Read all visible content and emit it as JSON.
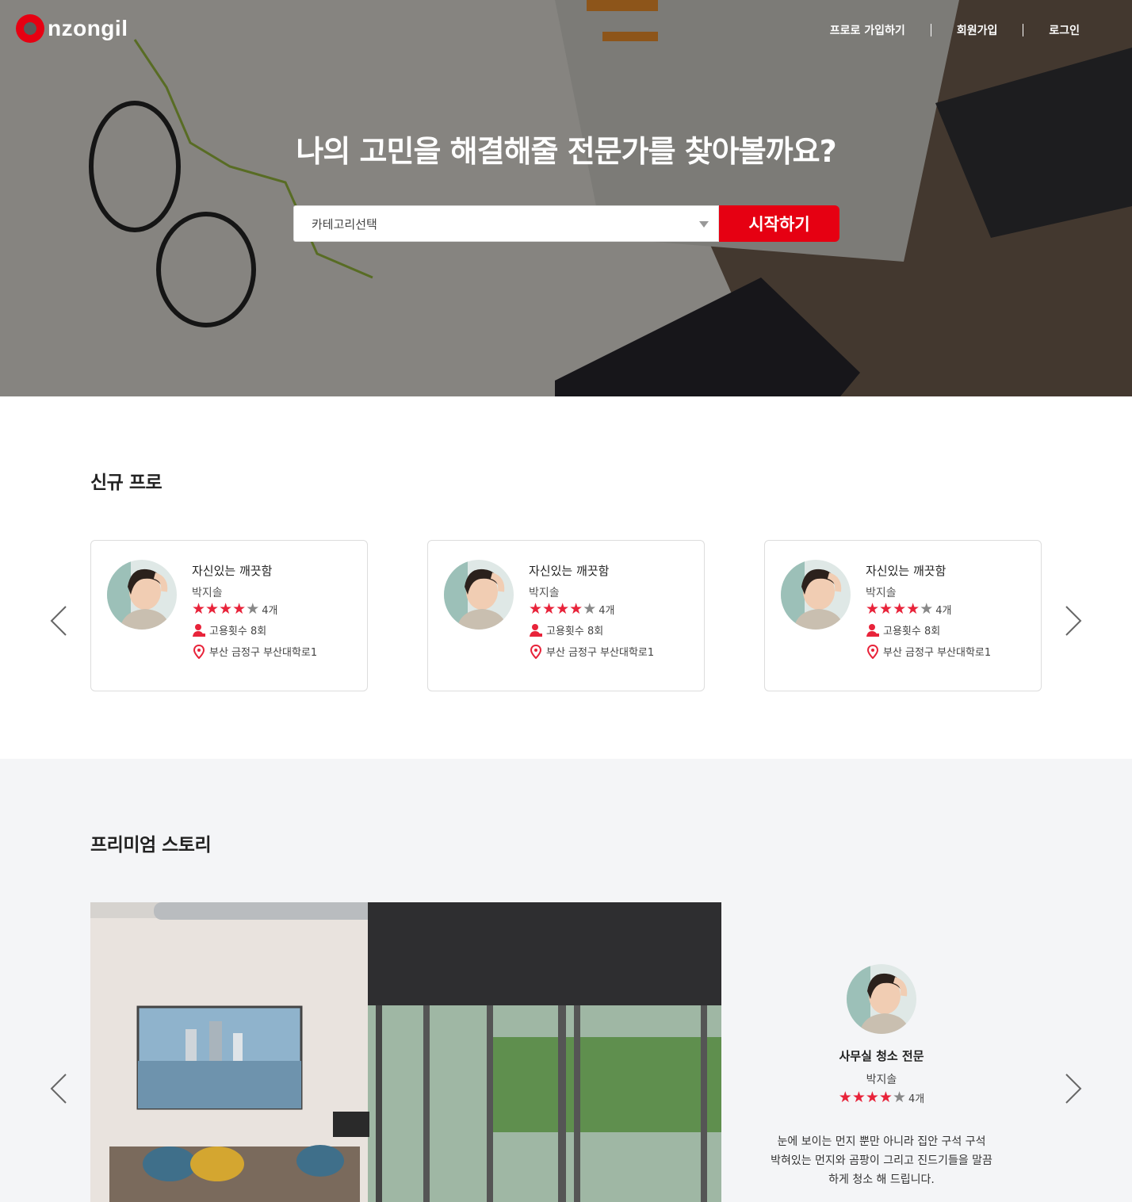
{
  "brand": {
    "logo_text": "nzongil",
    "accent": "#e60012"
  },
  "nav": {
    "items": [
      {
        "label": "프로로 가입하기"
      },
      {
        "label": "회원가입"
      },
      {
        "label": "로그인"
      }
    ]
  },
  "hero": {
    "title": "나의 고민을 해결해줄 전문가를 찾아볼까요?",
    "select_value": "카테고리선택",
    "start_label": "시작하기"
  },
  "new_pros": {
    "title": "신규 프로",
    "cards": [
      {
        "title": "자신있는 깨끗함",
        "name": "박지솔",
        "rating": 4,
        "rating_max": 5,
        "rating_count": "4개",
        "hires": "고용횟수 8회",
        "address": "부산 금정구 부산대학로1"
      },
      {
        "title": "자신있는 깨끗함",
        "name": "박지솔",
        "rating": 4,
        "rating_max": 5,
        "rating_count": "4개",
        "hires": "고용횟수 8회",
        "address": "부산 금정구 부산대학로1"
      },
      {
        "title": "자신있는 깨끗함",
        "name": "박지솔",
        "rating": 4,
        "rating_max": 5,
        "rating_count": "4개",
        "hires": "고용횟수 8회",
        "address": "부산 금정구 부산대학로1"
      }
    ]
  },
  "premium": {
    "title": "프리미엄 스토리",
    "story": {
      "title": "사무실 청소 전문",
      "name": "박지솔",
      "rating": 4,
      "rating_max": 5,
      "rating_count": "4개",
      "description": "눈에 보이는 먼지 뿐만 아니라 집안 구석 구석 박혀있는 먼지와 곰팡이 그리고 진드기들을 말끔하게 청소 해 드립니다."
    }
  }
}
